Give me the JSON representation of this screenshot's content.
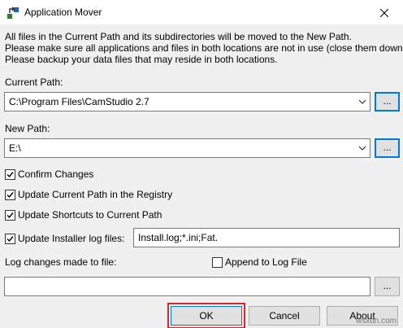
{
  "window": {
    "title": "Application Mover",
    "app_icon": "application-mover-icon",
    "close_icon": "close-icon"
  },
  "description": {
    "line1": "All files in the Current Path and its subdirectories will be moved to the New Path.",
    "line2": "Please make sure all applications and files in both locations are not in use (close them down).",
    "line3": "Please backup your data files that may reside in both locations."
  },
  "current_path": {
    "label": "Current Path:",
    "value": "C:\\Program Files\\CamStudio 2.7",
    "browse_label": "..."
  },
  "new_path": {
    "label": "New Path:",
    "value": "E:\\",
    "browse_label": "..."
  },
  "options": {
    "confirm_changes": {
      "label": "Confirm Changes",
      "checked": true
    },
    "update_registry": {
      "label": "Update Current Path in the Registry",
      "checked": true
    },
    "update_shortcuts": {
      "label": "Update Shortcuts to Current Path",
      "checked": true
    },
    "update_installer_logs": {
      "label": "Update Installer log files:",
      "checked": true,
      "value": "Install.log;*.ini;Fat."
    }
  },
  "log": {
    "label": "Log changes made to file:",
    "append_label": "Append to Log File",
    "append_checked": false,
    "value": "",
    "browse_label": "..."
  },
  "buttons": {
    "ok": "OK",
    "cancel": "Cancel",
    "about": "About"
  },
  "colors": {
    "accent": "#0078d7",
    "highlight": "#d9252b",
    "dialog_bg": "#f0f0f0"
  },
  "watermark": "wsxdn.com"
}
